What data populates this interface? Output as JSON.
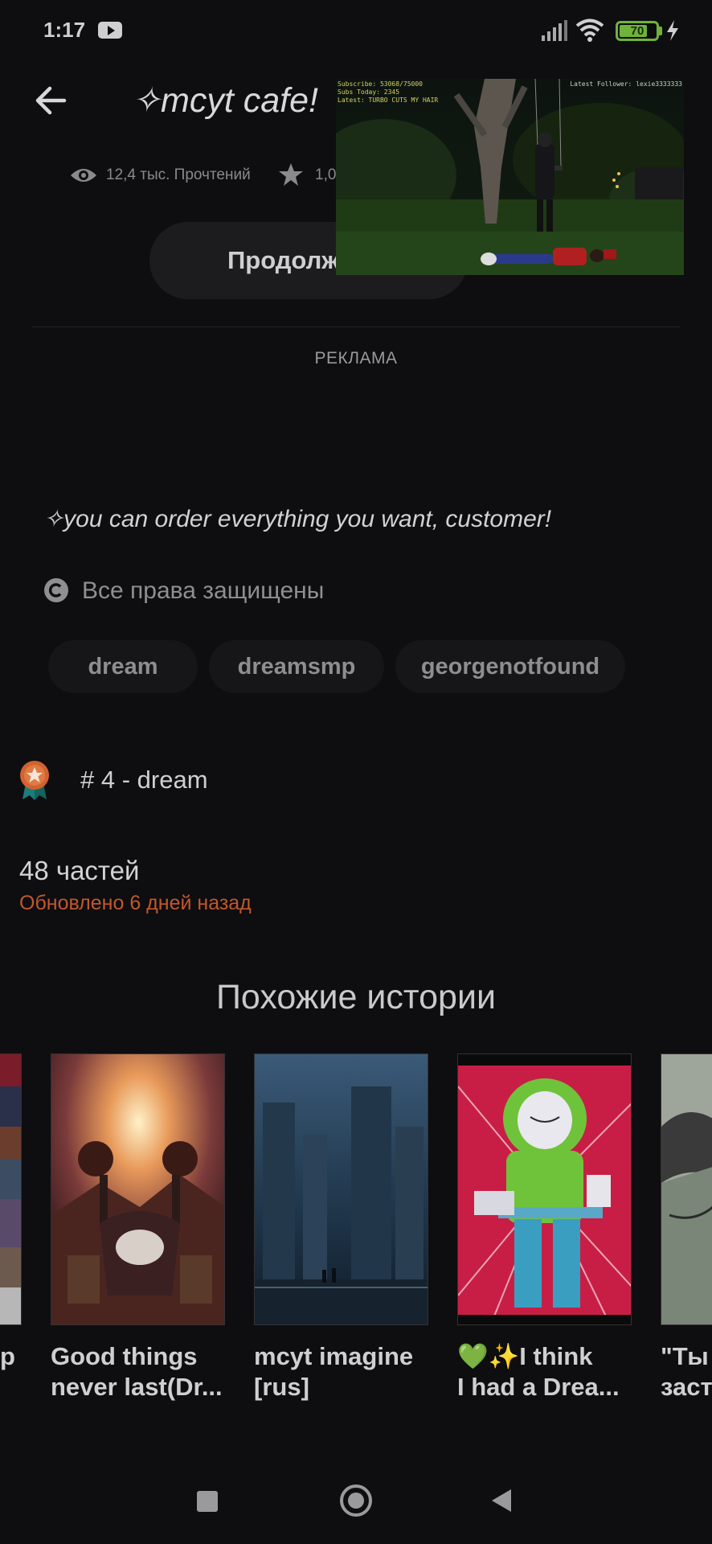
{
  "status_bar": {
    "time": "1:17",
    "battery_level": "70",
    "icons": [
      "youtube-icon",
      "signal-icon",
      "wifi-icon",
      "battery-icon",
      "charging-bolt-icon"
    ]
  },
  "header": {
    "title": "✧mcyt cafe!",
    "reads": "12,4 тыс. Прочтений",
    "votes": "1,0",
    "continue_label": "Продолж"
  },
  "video_overlay": {
    "line1": "Subscribe: 53068/75000",
    "line2": "Subs Today: 2345",
    "line3": "Latest: TURBO CUTS MY HAIR",
    "follower": "Latest Follower: lexie3333333"
  },
  "ad": {
    "label": "РЕКЛАМА"
  },
  "description": "✧you can order everything you want, customer!",
  "copyright": "Все права защищены",
  "tags": [
    "dream",
    "dreamsmp",
    "georgenotfound"
  ],
  "rank": "# 4 - dream",
  "parts": {
    "count": "48 частей",
    "updated": "Обновлено 6 дней назад"
  },
  "similar": {
    "heading": "Похожие истории",
    "items": [
      {
        "title_line1": "p",
        "title_line2": ""
      },
      {
        "title_line1": "Good things",
        "title_line2": "never last(Dr..."
      },
      {
        "title_line1": "mcyt imagine",
        "title_line2": "[rus]"
      },
      {
        "title_line1": "💚✨I think",
        "title_line2": "I had a Drea..."
      },
      {
        "title_line1": "\"Ты",
        "title_line2": "заст"
      }
    ]
  },
  "colors": {
    "background": "#0e0d10",
    "accent_orange": "#c2572c",
    "battery_green": "#6fb33a"
  }
}
